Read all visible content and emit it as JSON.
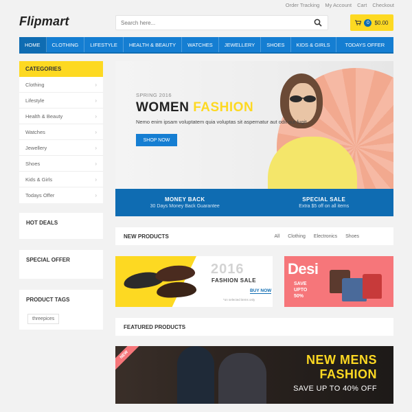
{
  "top_links": [
    "Order Tracking",
    "My Account",
    "Cart",
    "Checkout"
  ],
  "logo": "Flipmart",
  "search": {
    "placeholder": "Search here..."
  },
  "cart": {
    "count": "0",
    "total": "$0.00"
  },
  "nav": [
    "HOME",
    "CLOTHING",
    "LIFESTYLE",
    "HEALTH & BEAUTY",
    "WATCHES",
    "JEWELLERY",
    "SHOES",
    "KIDS & GIRLS",
    "TODAYS OFFER"
  ],
  "categories": {
    "title": "CATEGORIES",
    "items": [
      "Clothing",
      "Lifestyle",
      "Health & Beauty",
      "Watches",
      "Jewellery",
      "Shoes",
      "Kids & Girls",
      "Todays Offer"
    ]
  },
  "sidebar_boxes": {
    "hot_deals": "HOT DEALS",
    "special_offer": "SPECIAL OFFER",
    "product_tags": "PRODUCT TAGS",
    "tag": "threepices"
  },
  "hero": {
    "kicker": "SPRING 2016",
    "title_main": "WOMEN ",
    "title_accent": "FASHION",
    "description": "Nemo enim ipsam voluptatem quia voluptas sit aspernatur aut odit aut fugit",
    "button": "SHOP NOW"
  },
  "promo": [
    {
      "title": "MONEY BACK",
      "subtitle": "30 Days Money Back Guarantee"
    },
    {
      "title": "SPECIAL SALE",
      "subtitle": "Extra $5 off on all items"
    }
  ],
  "new_products": {
    "title": "NEW PRODUCTS",
    "tabs": [
      "All",
      "Clothing",
      "Electronics",
      "Shoes"
    ]
  },
  "banner_shoes": {
    "year": "2016",
    "title": "FASHION SALE",
    "button": "BUY NOW",
    "note": "*on selected items only"
  },
  "banner_bags": {
    "headline": "Desi",
    "save": "SAVE",
    "upto": "UPTO",
    "percent": "50%"
  },
  "featured": {
    "title": "FEATURED PRODUCTS"
  },
  "mens_banner": {
    "ribbon": "NEW",
    "line1": "NEW MENS",
    "line2": "FASHION",
    "save": "SAVE UP TO 40% OFF"
  }
}
